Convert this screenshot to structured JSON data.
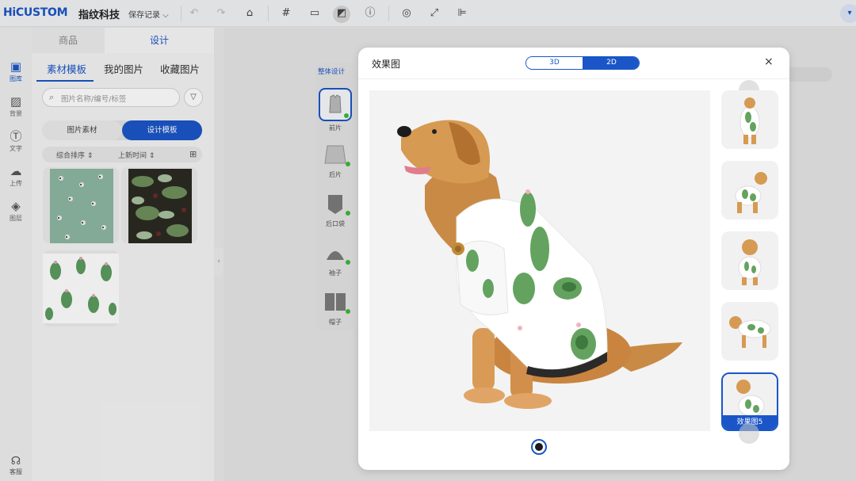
{
  "brand": {
    "logo": "HiCUSTOM",
    "company": "指纹科技"
  },
  "toolbar": {
    "save_record": "保存记录",
    "icons": [
      "undo-icon",
      "redo-icon",
      "clear-icon",
      "grid-icon",
      "ruler-icon",
      "layer-order-icon",
      "info-icon",
      "template-icon",
      "fullscreen-icon",
      "align-icon",
      "cart-icon"
    ]
  },
  "leftrail": {
    "items": [
      {
        "label": "图库",
        "icon": "image-icon"
      },
      {
        "label": "背景",
        "icon": "background-icon"
      },
      {
        "label": "文字",
        "icon": "text-icon"
      },
      {
        "label": "上传",
        "icon": "upload-icon"
      },
      {
        "label": "图层",
        "icon": "layers-icon"
      }
    ],
    "service": "客服"
  },
  "panel": {
    "tabs": [
      "商品",
      "设计"
    ],
    "subtabs": [
      "素材模板",
      "我的图片",
      "收藏图片"
    ],
    "search_placeholder": "图片名称/编号/标签",
    "segments": [
      "图片素材",
      "设计模板"
    ],
    "sort": [
      "综合排序 ⇕",
      "上新时间 ⇕"
    ]
  },
  "pieces": {
    "overall": "整体设计",
    "items": [
      "前片",
      "后片",
      "后口袋",
      "袖子",
      "帽子"
    ]
  },
  "modal": {
    "title": "效果图",
    "toggle": [
      "3D",
      "2D"
    ],
    "close": "×",
    "selected_label": "效果图5"
  },
  "colors": {
    "accent": "#1a56c8",
    "indicator": "#3db839"
  }
}
